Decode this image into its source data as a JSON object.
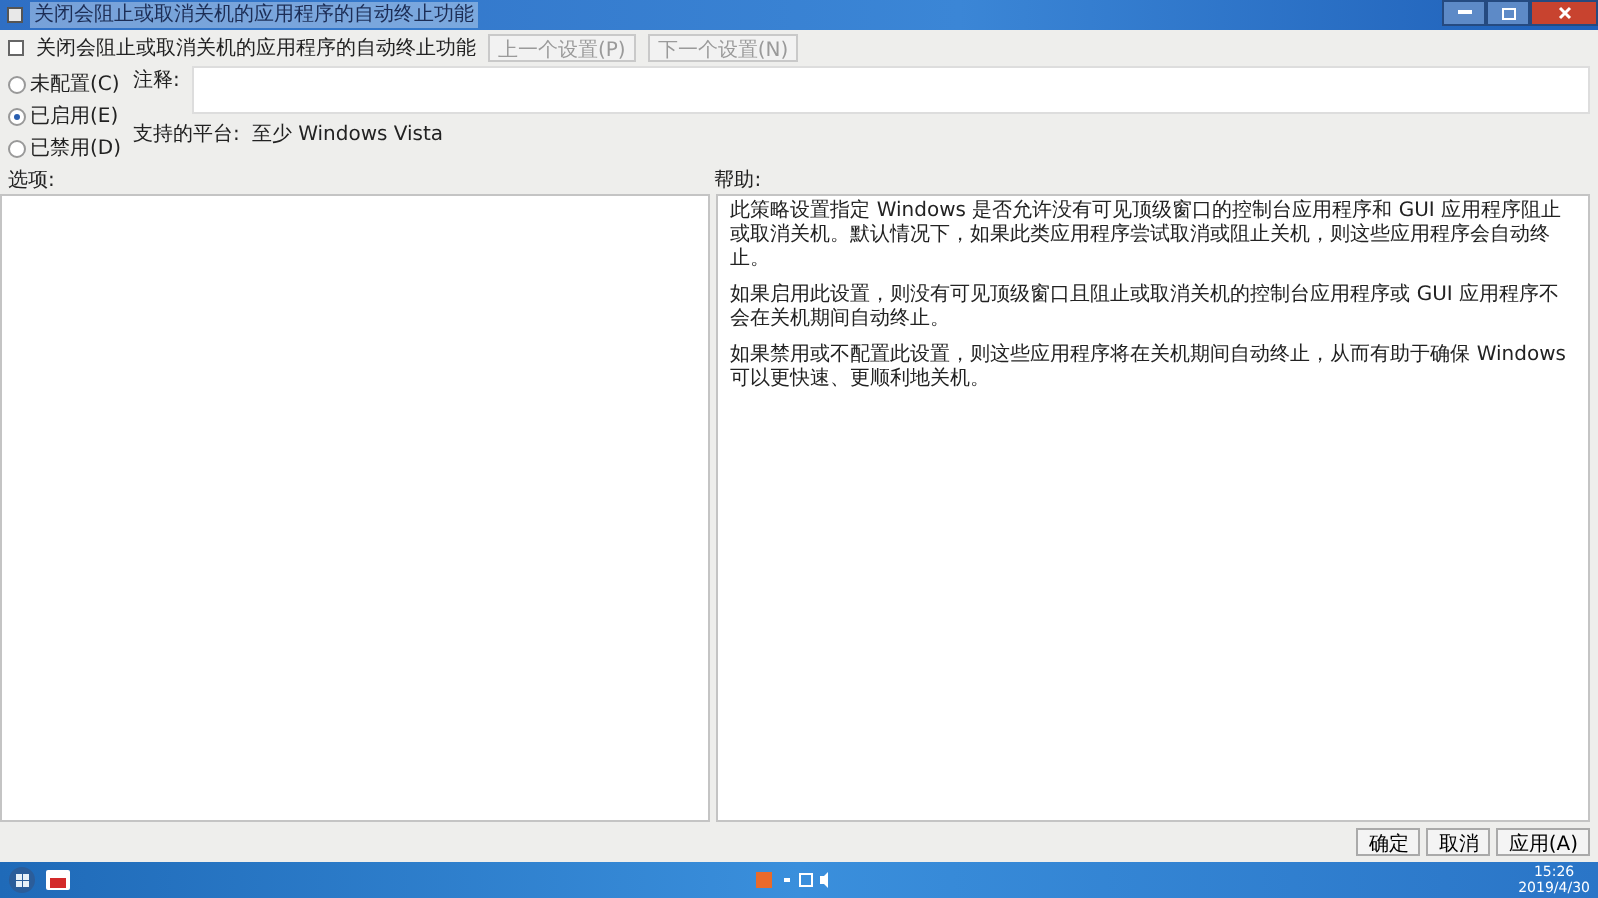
{
  "window": {
    "title": "关闭会阻止或取消关机的应用程序的自动终止功能"
  },
  "header": {
    "policy_name": "关闭会阻止或取消关机的应用程序的自动终止功能",
    "nav_buttons": [
      {
        "label": "上一个设置(P)",
        "disabled": true
      },
      {
        "label": "下一个设置(N)",
        "disabled": true
      }
    ]
  },
  "state_options": [
    {
      "label": "未配置(C)",
      "selected": false
    },
    {
      "label": "已启用(E)",
      "selected": true
    },
    {
      "label": "已禁用(D)",
      "selected": false
    }
  ],
  "comment": {
    "label": "注释:"
  },
  "platform": {
    "label": "支持的平台:",
    "value": "至少 Windows Vista"
  },
  "options_panel": {
    "label": "选项:"
  },
  "help_panel": {
    "label": "帮助:",
    "paragraphs": [
      "此策略设置指定 Windows 是否允许没有可见顶级窗口的控制台应用程序和 GUI 应用程序阻止或取消关机。默认情况下，如果此类应用程序尝试取消或阻止关机，则这些应用程序会自动终止。",
      "如果启用此设置，则没有可见顶级窗口且阻止或取消关机的控制台应用程序或 GUI 应用程序不会在关机期间自动终止。",
      "如果禁用或不配置此设置，则这些应用程序将在关机期间自动终止，从而有助于确保 Windows 可以更快速、更顺利地关机。"
    ]
  },
  "buttons": [
    "确定",
    "取消",
    "应用(A)"
  ],
  "taskbar": {
    "time": "15:26",
    "date": "2019/4/30"
  }
}
